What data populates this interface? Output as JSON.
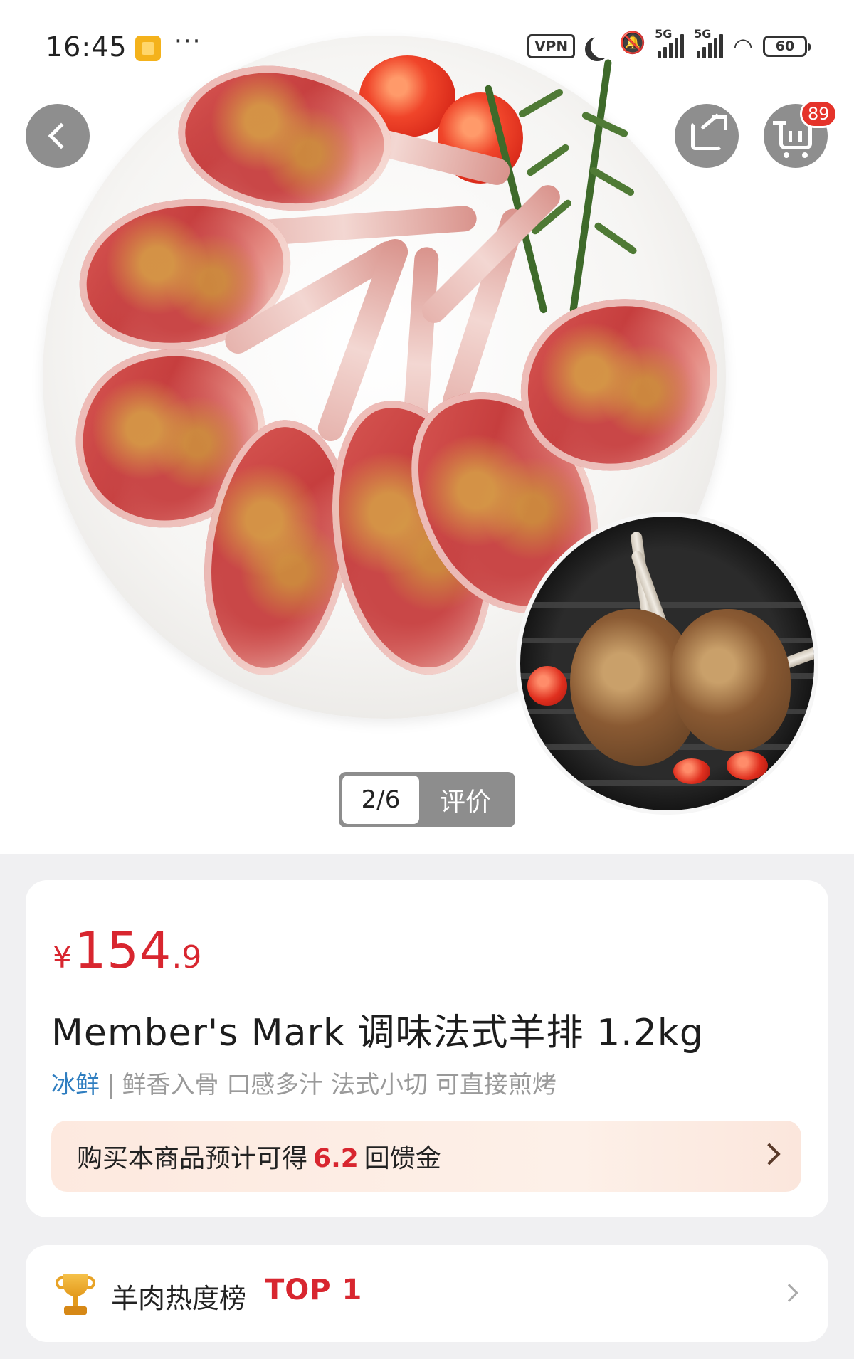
{
  "status_bar": {
    "time": "16:45",
    "menu_dots": "···",
    "vpn_label": "VPN",
    "network_1": "5G",
    "network_2": "5G",
    "battery": "60"
  },
  "header": {
    "cart_badge": "89",
    "icons": {
      "back": "chevron-left-icon",
      "share": "share-icon",
      "cart": "shopping-cart-icon"
    }
  },
  "gallery": {
    "counter": "2/6",
    "review_tab": "评价"
  },
  "product": {
    "currency": "¥",
    "price_integer": "154",
    "price_decimal": ".9",
    "title": "Member's Mark 调味法式羊排 1.2kg",
    "tag_primary": "冰鲜",
    "tag_separator": "|",
    "tag_features": "鲜香入骨 口感多汁 法式小切 可直接煎烤"
  },
  "rebate": {
    "prefix": "购买本商品预计可得",
    "amount": "6.2",
    "suffix": "回馈金"
  },
  "ranking": {
    "label": "羊肉热度榜",
    "top": "TOP 1"
  },
  "colors": {
    "price_red": "#d8262f",
    "tag_blue": "#2f7ec0",
    "badge_red": "#e5332a",
    "rebate_bg": "#fde9df",
    "page_bg": "#f0f0f2"
  }
}
